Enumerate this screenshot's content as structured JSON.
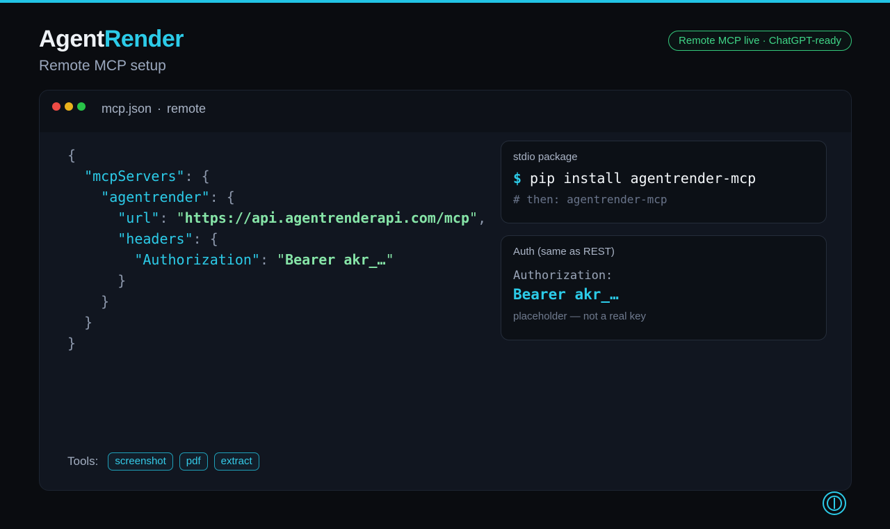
{
  "header": {
    "brand_part1": "Agent",
    "brand_part2": "Render",
    "subtitle": "Remote MCP setup",
    "status_badge": "Remote MCP live · ChatGPT-ready"
  },
  "window": {
    "file_name": "mcp.json",
    "separator": "·",
    "mode": "remote",
    "traffic_lights": [
      "#ee4b45",
      "#e9b21c",
      "#28c448"
    ]
  },
  "code": {
    "key_mcpServers": "\"mcpServers\"",
    "key_agentrender": "\"agentrender\"",
    "key_url": "\"url\"",
    "value_url": "https://api.agentrenderapi.com/mcp",
    "key_headers": "\"headers\"",
    "key_authorization": "\"Authorization\"",
    "value_authorization": "Bearer akr_…"
  },
  "stdio_panel": {
    "title": "stdio package",
    "prompt": "$",
    "command": "pip install agentrender-mcp",
    "comment": "# then: agentrender-mcp"
  },
  "auth_panel": {
    "title": "Auth (same as REST)",
    "header_key": "Authorization:",
    "header_value": "Bearer akr_…",
    "note": "placeholder — not a real key"
  },
  "tools": {
    "label": "Tools:",
    "items": [
      "screenshot",
      "pdf",
      "extract"
    ]
  },
  "colors": {
    "accent": "#2ccbe8",
    "live_green": "#3fd486",
    "string_green": "#86e4a7",
    "background": "#0a0c10"
  },
  "icons": {
    "bottom_right": "power-icon"
  }
}
